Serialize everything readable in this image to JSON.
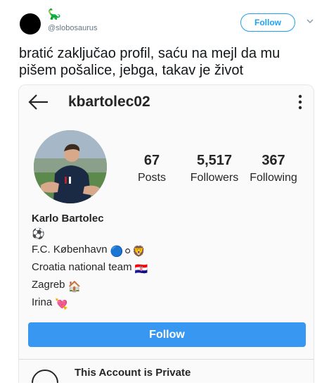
{
  "tweet": {
    "author_handle": "@slobosaurus",
    "follow_label": "Follow",
    "text_lines": [
      "bratić zaključao profil, saću na mejl da mu",
      "pišem pošalice, jebga, takav je život"
    ]
  },
  "instagram": {
    "username": "kbartolec02",
    "stats": [
      {
        "value": "67",
        "label": "Posts"
      },
      {
        "value": "5,517",
        "label": "Followers"
      },
      {
        "value": "367",
        "label": "Following"
      }
    ],
    "bio": {
      "name": "Karlo Bartolec",
      "line_soccer": "⚽",
      "club": "F.C. København",
      "club_emojis": "🔵⚪🦁",
      "team": "Croatia national team",
      "team_emoji": "🇭🇷",
      "city": "Zagreb",
      "city_emoji": "🏠",
      "partner": "Irina",
      "partner_emoji": "💘"
    },
    "follow_label": "Follow",
    "private_title": "This Account is Private"
  },
  "colors": {
    "twitter_blue": "#1da1f2",
    "ig_blue": "#3897f0",
    "text": "#262626"
  }
}
